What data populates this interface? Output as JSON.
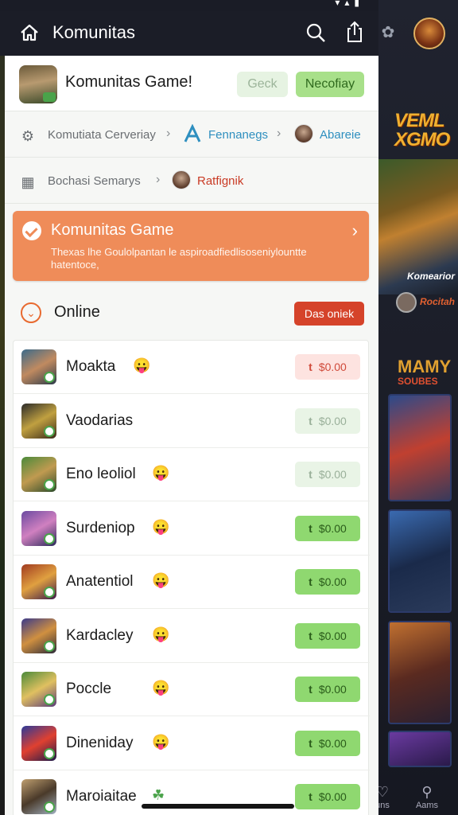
{
  "app": {
    "title": "Komunitas"
  },
  "header": {
    "name": "Komunitas Game!",
    "btn_secondary": "Geck",
    "btn_primary": "Necofiay"
  },
  "breadcrumb1": {
    "item1": "Komutiata Cerveriay",
    "item2": "Fennanegs",
    "item3": "Abareie"
  },
  "breadcrumb2": {
    "item1": "Bochasi Semarys",
    "item2": "Ratfignik"
  },
  "promo": {
    "title": "Komunitas Game",
    "desc": "Thexas lhe Goulolpantan le aspiroadfiedlisoseniylountte hatentoce,"
  },
  "online": {
    "label": "Online",
    "button": "Das oniek"
  },
  "list": [
    {
      "name": "Moakta",
      "emoji": "😛",
      "price": "$0.00",
      "style": "red",
      "icon": "t"
    },
    {
      "name": "Vaodarias",
      "emoji": "",
      "price": "$0.00",
      "style": "pale",
      "icon": "t"
    },
    {
      "name": "Eno leoliol",
      "emoji": "😛",
      "price": "$0.00",
      "style": "pale",
      "icon": "t"
    },
    {
      "name": "Surdeniop",
      "emoji": "😛",
      "price": "$0.00",
      "style": "green",
      "icon": "t"
    },
    {
      "name": "Anatentiol",
      "emoji": "😛",
      "price": "$0.00",
      "style": "green",
      "icon": "t"
    },
    {
      "name": "Kardacley",
      "emoji": "😛",
      "price": "$0.00",
      "style": "green",
      "icon": "t"
    },
    {
      "name": "Poccle",
      "emoji": "😛",
      "price": "$0.00",
      "style": "green",
      "icon": "t"
    },
    {
      "name": "Dineniday",
      "emoji": "😛",
      "price": "$0.00",
      "style": "green",
      "icon": "t"
    },
    {
      "name": "Maroiaitae",
      "emoji": "☘",
      "price": "$0.00",
      "style": "green",
      "icon": "t"
    }
  ],
  "side": {
    "title1": "VEML XGMO",
    "banner_caption": "Komearior",
    "mini_label": "Rocitah",
    "title2": "MAMY",
    "sub2": "SOUBES",
    "tab1": "uns",
    "tab2": "Aams"
  }
}
